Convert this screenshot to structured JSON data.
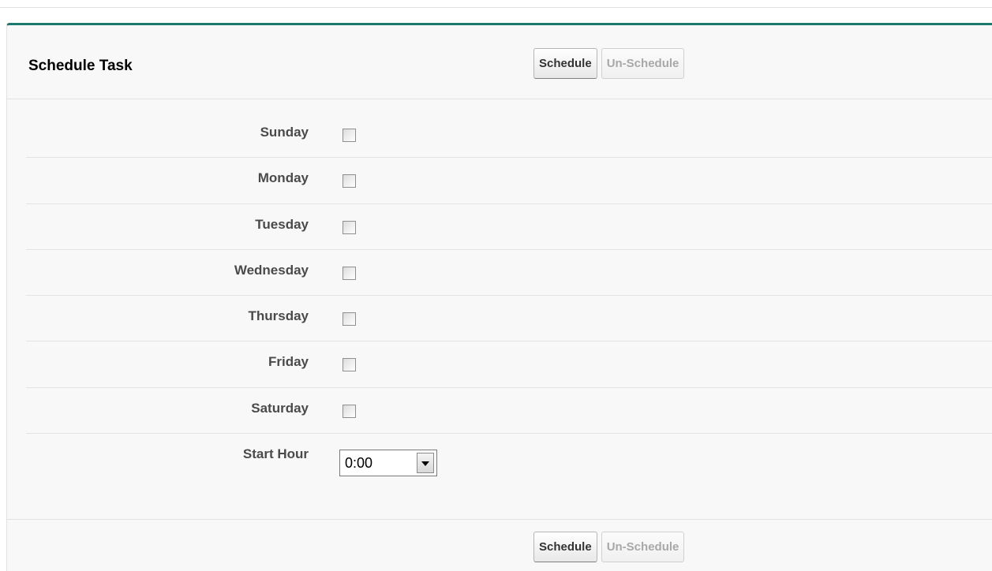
{
  "header": {
    "title": "Schedule Task",
    "schedule_label": "Schedule",
    "unschedule_label": "Un-Schedule"
  },
  "days": [
    {
      "label": "Sunday",
      "checked": false
    },
    {
      "label": "Monday",
      "checked": false
    },
    {
      "label": "Tuesday",
      "checked": false
    },
    {
      "label": "Wednesday",
      "checked": false
    },
    {
      "label": "Thursday",
      "checked": false
    },
    {
      "label": "Friday",
      "checked": false
    },
    {
      "label": "Saturday",
      "checked": false
    }
  ],
  "start_hour": {
    "label": "Start Hour",
    "value": "0:00"
  },
  "footer": {
    "schedule_label": "Schedule",
    "unschedule_label": "Un-Schedule"
  },
  "colors": {
    "accent": "#1b7a6e",
    "panel_bg": "#f8f8f8"
  }
}
